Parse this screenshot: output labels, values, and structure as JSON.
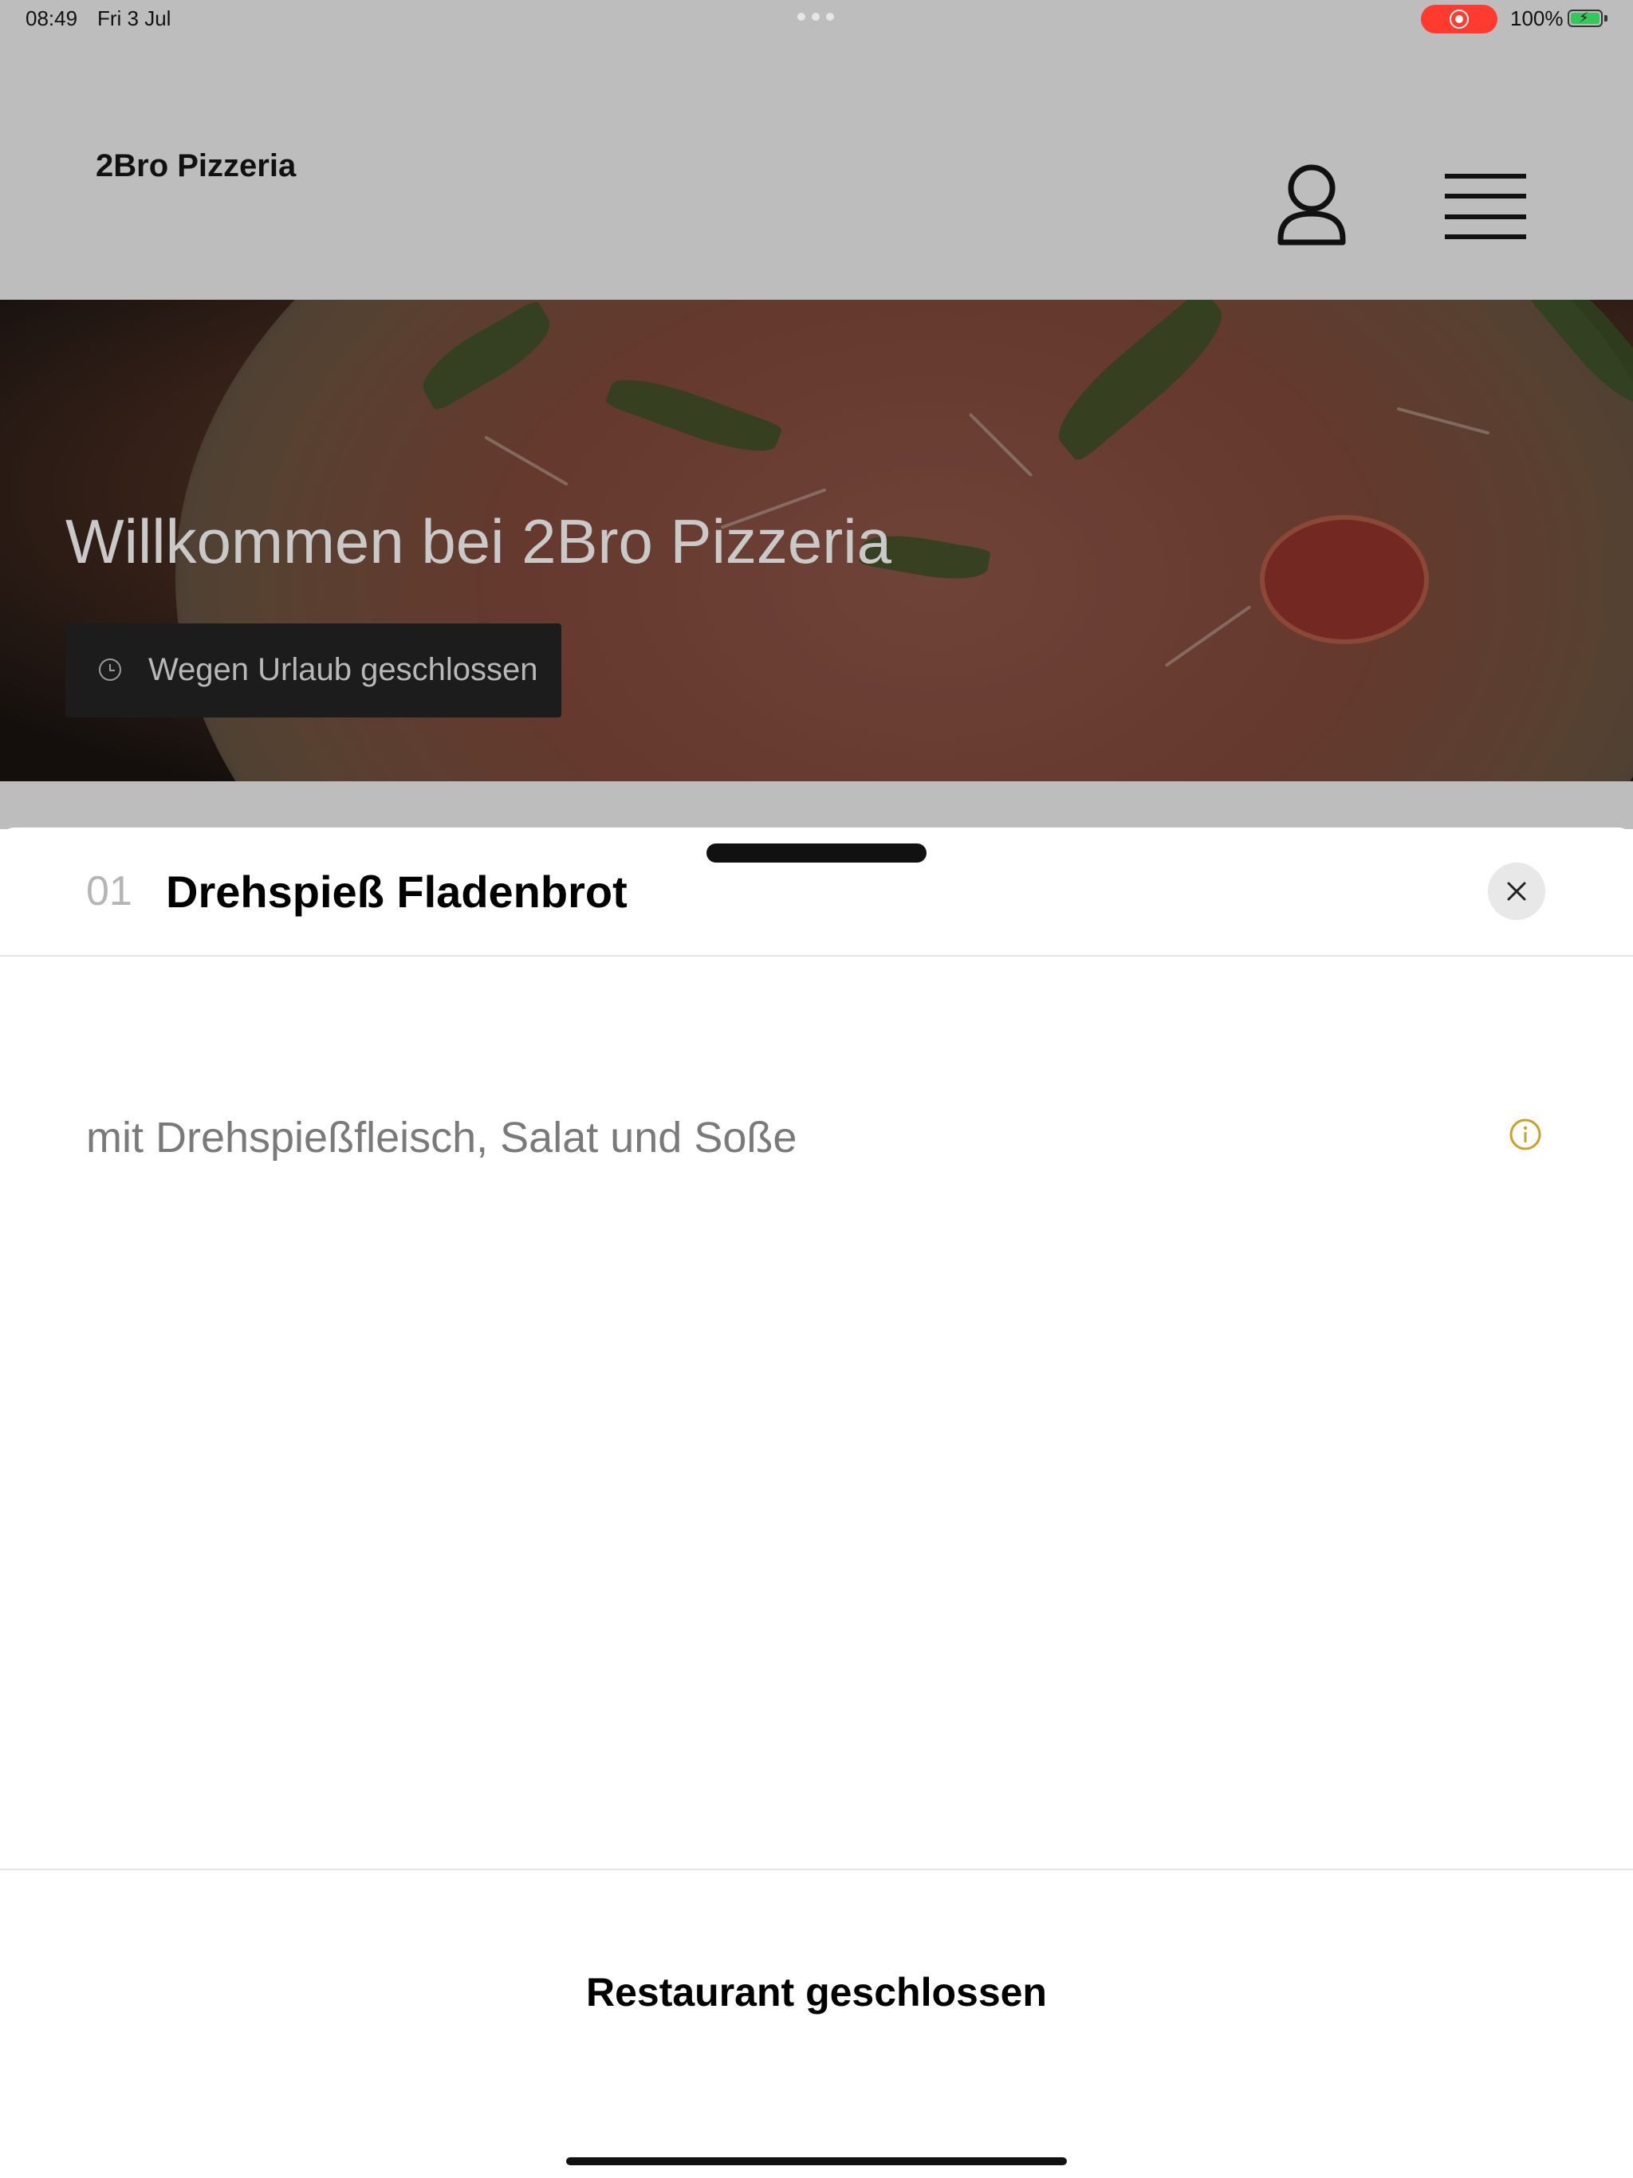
{
  "status_bar": {
    "time": "08:49",
    "date": "Fri 3 Jul",
    "battery": "100%"
  },
  "header": {
    "brand": "2Bro Pizzeria",
    "icons": [
      "person-icon",
      "hamburger-menu-icon"
    ]
  },
  "hero": {
    "title": "Willkommen bei 2Bro Pizzeria",
    "status_badge": "Wegen Urlaub geschlossen",
    "status_icon": "clock-icon"
  },
  "item_sheet": {
    "number": "01",
    "title": "Drehspieß Fladenbrot",
    "description": "mit Drehspießfleisch, Salat und Soße",
    "close_icon": "close-icon",
    "info_icon": "info-icon",
    "footer_label": "Restaurant geschlossen"
  },
  "colors": {
    "info_accent": "#c9a227",
    "recording": "#ff3b30",
    "battery": "#34c759"
  }
}
